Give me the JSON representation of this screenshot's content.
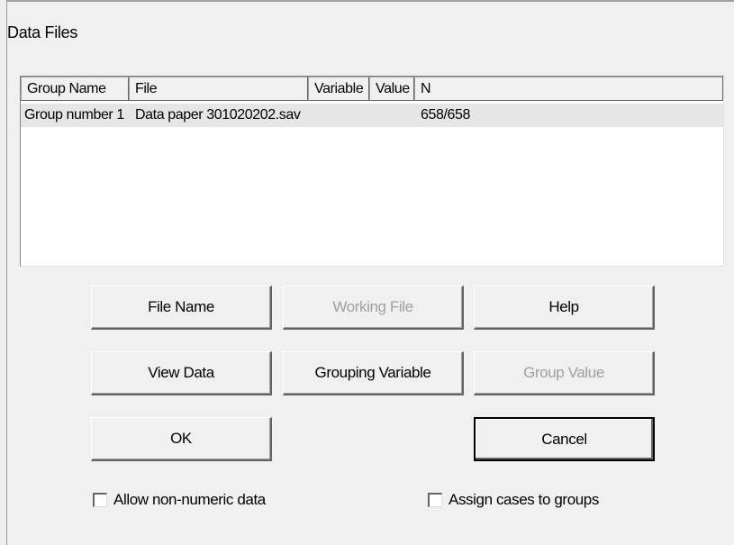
{
  "dialog": {
    "title": "Data Files"
  },
  "table": {
    "columns": [
      "Group Name",
      "File",
      "Variable",
      "Value",
      "N"
    ],
    "rows": [
      {
        "group_name": "Group number 1",
        "file": "Data paper 301020202.sav",
        "variable": "",
        "value": "",
        "n": "658/658"
      }
    ]
  },
  "buttons": {
    "file_name": "File Name",
    "working_file": "Working File",
    "help": "Help",
    "view_data": "View Data",
    "grouping_variable": "Grouping Variable",
    "group_value": "Group Value",
    "ok": "OK",
    "cancel": "Cancel"
  },
  "checkboxes": {
    "allow_non_numeric": {
      "label": "Allow non-numeric data",
      "checked": false
    },
    "assign_cases": {
      "label": "Assign cases to groups",
      "checked": false
    }
  }
}
